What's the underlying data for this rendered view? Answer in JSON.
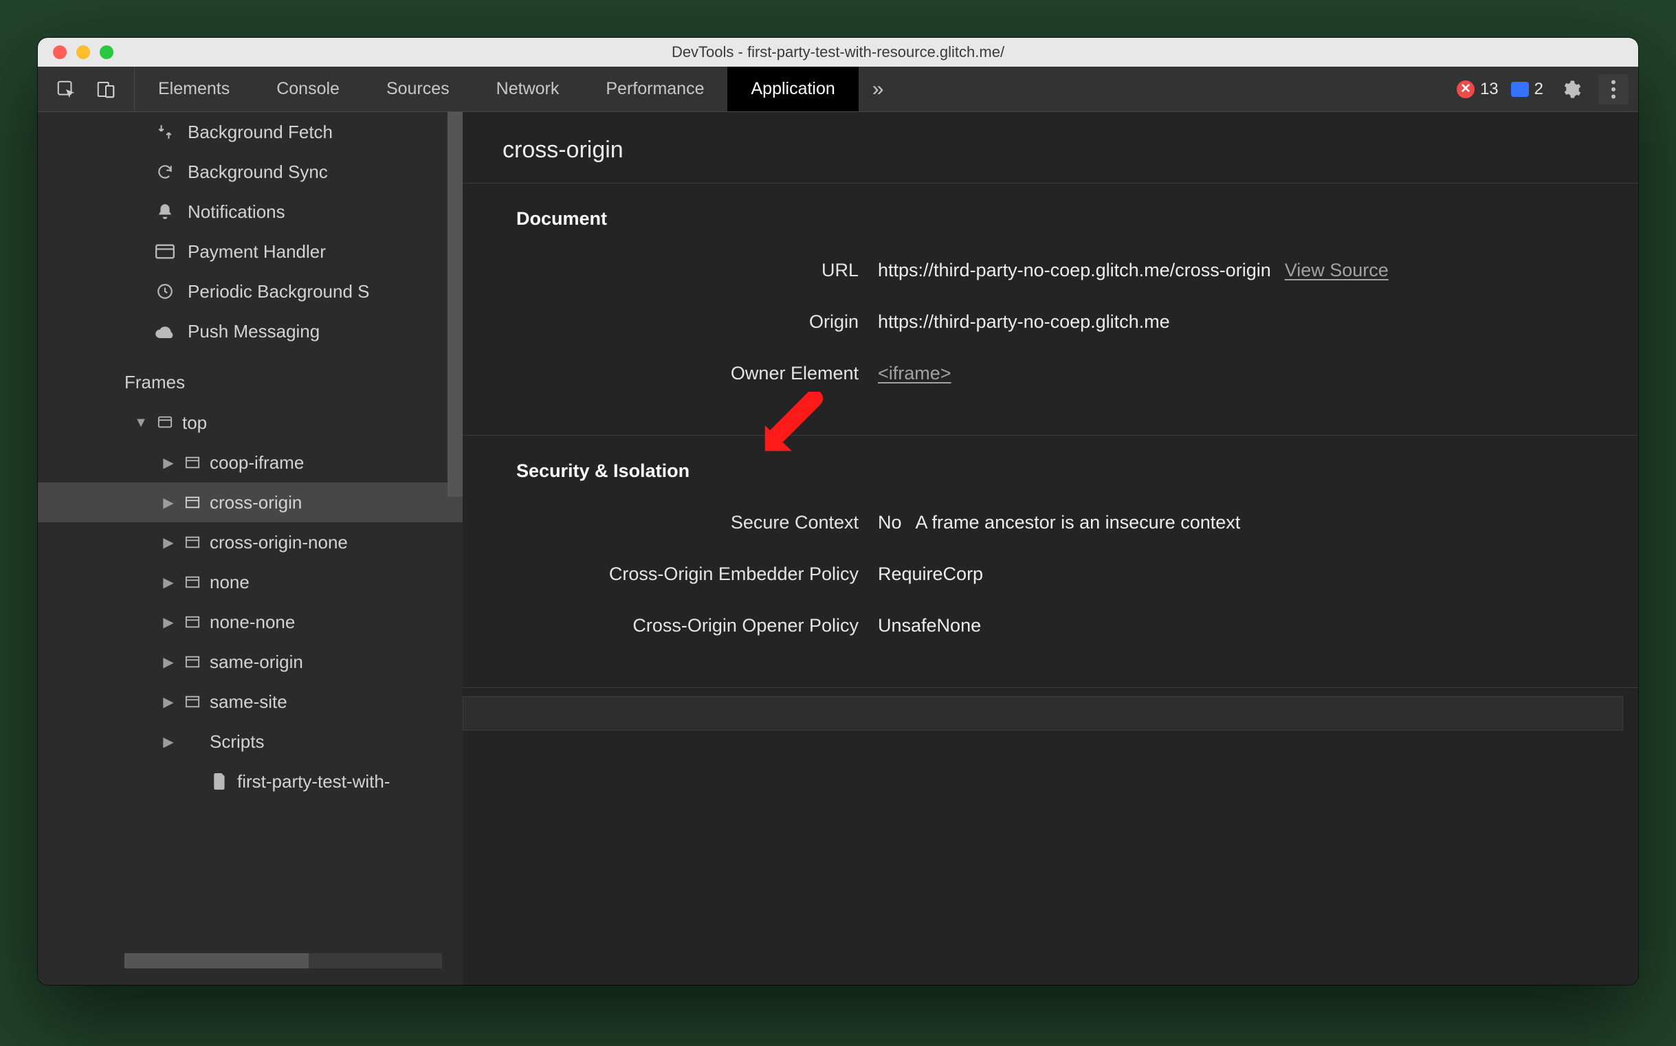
{
  "window_title": "DevTools - first-party-test-with-resource.glitch.me/",
  "tabs": {
    "items": [
      "Elements",
      "Console",
      "Sources",
      "Network",
      "Performance",
      "Application"
    ],
    "active": "Application",
    "overflow_glyph": "»"
  },
  "toolbar_right": {
    "error_count": "13",
    "info_count": "2"
  },
  "sidebar_top": [
    {
      "icon": "fetch",
      "label": "Background Fetch"
    },
    {
      "icon": "sync",
      "label": "Background Sync"
    },
    {
      "icon": "bell",
      "label": "Notifications"
    },
    {
      "icon": "card",
      "label": "Payment Handler"
    },
    {
      "icon": "clock",
      "label": "Periodic Background S"
    },
    {
      "icon": "cloud",
      "label": "Push Messaging"
    }
  ],
  "frames_title": "Frames",
  "frames_tree": [
    {
      "depth": 0,
      "collapsed": false,
      "icon": "window",
      "label": "top",
      "expander": "▼"
    },
    {
      "depth": 1,
      "collapsed": true,
      "icon": "frame",
      "label": "coop-iframe",
      "expander": "▶"
    },
    {
      "depth": 1,
      "collapsed": true,
      "icon": "frame",
      "label": "cross-origin",
      "expander": "▶",
      "selected": true
    },
    {
      "depth": 1,
      "collapsed": true,
      "icon": "frame",
      "label": "cross-origin-none",
      "expander": "▶"
    },
    {
      "depth": 1,
      "collapsed": true,
      "icon": "frame",
      "label": "none",
      "expander": "▶"
    },
    {
      "depth": 1,
      "collapsed": true,
      "icon": "frame",
      "label": "none-none",
      "expander": "▶"
    },
    {
      "depth": 1,
      "collapsed": true,
      "icon": "frame",
      "label": "same-origin",
      "expander": "▶"
    },
    {
      "depth": 1,
      "collapsed": true,
      "icon": "frame",
      "label": "same-site",
      "expander": "▶"
    },
    {
      "depth": 1,
      "collapsed": true,
      "icon": "folder",
      "label": "Scripts",
      "expander": "▶"
    },
    {
      "depth": 2,
      "collapsed": true,
      "icon": "doc",
      "label": "first-party-test-with-",
      "expander": ""
    }
  ],
  "detail": {
    "title": "cross-origin",
    "section1": {
      "heading": "Document",
      "rows": [
        {
          "k": "URL",
          "v": "https://third-party-no-coep.glitch.me/cross-origin",
          "link": "View Source"
        },
        {
          "k": "Origin",
          "v": "https://third-party-no-coep.glitch.me"
        },
        {
          "k": "Owner Element",
          "link": "<iframe>"
        }
      ]
    },
    "section2": {
      "heading": "Security & Isolation",
      "rows": [
        {
          "k": "Secure Context",
          "v": "No",
          "extra": "A frame ancestor is an insecure context"
        },
        {
          "k": "Cross-Origin Embedder Policy",
          "v": "RequireCorp"
        },
        {
          "k": "Cross-Origin Opener Policy",
          "v": "UnsafeNone"
        }
      ]
    }
  }
}
